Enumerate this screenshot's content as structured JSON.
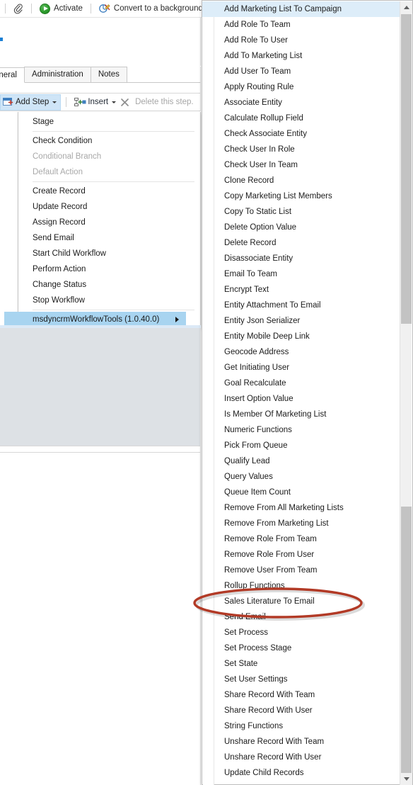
{
  "command_bar": {
    "clip_icon": "paperclip-icon",
    "activate": {
      "label": "Activate",
      "icon": "activate-icon"
    },
    "convert": {
      "label": "Convert to a background",
      "icon": "convert-background-icon"
    }
  },
  "tabs": [
    {
      "label": "eneral",
      "active": true
    },
    {
      "label": "Administration",
      "active": false
    },
    {
      "label": "Notes",
      "active": false
    }
  ],
  "step_toolbar": {
    "add_step": {
      "label": "Add Step",
      "icon": "add-step-icon",
      "caret": "chevron-down-icon"
    },
    "insert": {
      "label": "Insert",
      "icon": "insert-icon",
      "caret": "chevron-down-icon"
    },
    "delete_step": {
      "label": "Delete this step.",
      "icon": "close-x-icon",
      "disabled": true
    }
  },
  "step_menu": {
    "items": [
      {
        "label": "Stage",
        "disabled": false,
        "selected": false,
        "separator_after": true
      },
      {
        "label": "Check Condition",
        "disabled": false,
        "selected": false,
        "separator_after": false
      },
      {
        "label": "Conditional Branch",
        "disabled": true,
        "selected": false,
        "separator_after": false
      },
      {
        "label": "Default Action",
        "disabled": true,
        "selected": false,
        "separator_after": true
      },
      {
        "label": "Create Record",
        "disabled": false,
        "selected": false,
        "separator_after": false
      },
      {
        "label": "Update Record",
        "disabled": false,
        "selected": false,
        "separator_after": false
      },
      {
        "label": "Assign Record",
        "disabled": false,
        "selected": false,
        "separator_after": false
      },
      {
        "label": "Send Email",
        "disabled": false,
        "selected": false,
        "separator_after": false
      },
      {
        "label": "Start Child Workflow",
        "disabled": false,
        "selected": false,
        "separator_after": false
      },
      {
        "label": "Perform Action",
        "disabled": false,
        "selected": false,
        "separator_after": false
      },
      {
        "label": "Change Status",
        "disabled": false,
        "selected": false,
        "separator_after": false
      },
      {
        "label": "Stop Workflow",
        "disabled": false,
        "selected": false,
        "separator_after": true
      },
      {
        "label": "msdyncrmWorkflowTools (1.0.40.0)",
        "disabled": false,
        "selected": true,
        "has_submenu": true,
        "separator_after": false
      }
    ]
  },
  "flyout_menu": {
    "items": [
      {
        "label": "Add Marketing List To Campaign",
        "selected": true
      },
      {
        "label": "Add Role To Team",
        "selected": false
      },
      {
        "label": "Add Role To User",
        "selected": false
      },
      {
        "label": "Add To Marketing List",
        "selected": false
      },
      {
        "label": "Add User To Team",
        "selected": false
      },
      {
        "label": "Apply Routing Rule",
        "selected": false
      },
      {
        "label": "Associate Entity",
        "selected": false
      },
      {
        "label": "Calculate Rollup Field",
        "selected": false
      },
      {
        "label": "Check Associate Entity",
        "selected": false
      },
      {
        "label": "Check User In Role",
        "selected": false
      },
      {
        "label": "Check User In Team",
        "selected": false
      },
      {
        "label": "Clone Record",
        "selected": false
      },
      {
        "label": "Copy Marketing List Members",
        "selected": false
      },
      {
        "label": "Copy To Static List",
        "selected": false
      },
      {
        "label": "Delete Option Value",
        "selected": false
      },
      {
        "label": "Delete Record",
        "selected": false
      },
      {
        "label": "Disassociate Entity",
        "selected": false
      },
      {
        "label": "Email To Team",
        "selected": false
      },
      {
        "label": "Encrypt Text",
        "selected": false
      },
      {
        "label": "Entity Attachment To Email",
        "selected": false
      },
      {
        "label": "Entity Json Serializer",
        "selected": false
      },
      {
        "label": "Entity Mobile Deep Link",
        "selected": false
      },
      {
        "label": "Geocode Address",
        "selected": false
      },
      {
        "label": "Get Initiating User",
        "selected": false
      },
      {
        "label": "Goal Recalculate",
        "selected": false
      },
      {
        "label": "Insert Option Value",
        "selected": false
      },
      {
        "label": "Is Member Of Marketing List",
        "selected": false
      },
      {
        "label": "Numeric Functions",
        "selected": false
      },
      {
        "label": "Pick From Queue",
        "selected": false
      },
      {
        "label": "Qualify Lead",
        "selected": false
      },
      {
        "label": "Query Values",
        "selected": false
      },
      {
        "label": "Queue Item Count",
        "selected": false
      },
      {
        "label": "Remove From All Marketing Lists",
        "selected": false
      },
      {
        "label": "Remove From Marketing List",
        "selected": false
      },
      {
        "label": "Remove Role From Team",
        "selected": false
      },
      {
        "label": "Remove Role From User",
        "selected": false
      },
      {
        "label": "Remove User From Team",
        "selected": false
      },
      {
        "label": "Rollup Functions",
        "selected": false
      },
      {
        "label": "Sales Literature To Email",
        "selected": false,
        "annotated": true
      },
      {
        "label": "Send Email",
        "selected": false
      },
      {
        "label": "Set Process",
        "selected": false
      },
      {
        "label": "Set Process Stage",
        "selected": false
      },
      {
        "label": "Set State",
        "selected": false
      },
      {
        "label": "Set User Settings",
        "selected": false
      },
      {
        "label": "Share Record With Team",
        "selected": false
      },
      {
        "label": "Share Record With User",
        "selected": false
      },
      {
        "label": "String Functions",
        "selected": false
      },
      {
        "label": "Unshare Record With Team",
        "selected": false
      },
      {
        "label": "Unshare Record With User",
        "selected": false
      },
      {
        "label": "Update Child Records",
        "selected": false
      }
    ],
    "scrollbar": {
      "up_arrow": "scroll-up-arrow-icon",
      "down_arrow": "scroll-down-arrow-icon"
    }
  },
  "annotation": {
    "shape": "ellipse",
    "color": "#b23a26",
    "target_label": "Sales Literature To Email"
  },
  "colors": {
    "selection": "#a8d4f0",
    "flyout_selection": "#ddedf9",
    "annotation": "#b23a26",
    "canvas_grey": "#dde1e5",
    "activate_green": "#2e9e2e"
  }
}
